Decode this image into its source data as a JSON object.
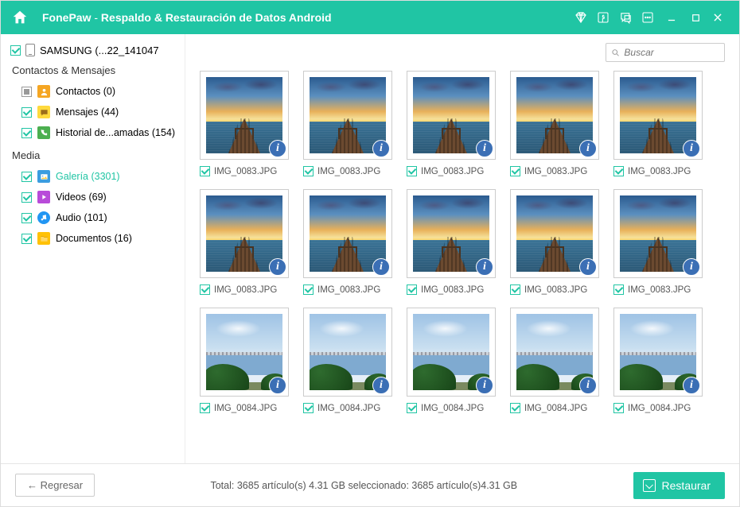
{
  "titlebar": {
    "brand": "FonePaw",
    "separator": " -  ",
    "product": "Respaldo & Restauración de Datos Android"
  },
  "sidebar": {
    "device_name": "SAMSUNG (...22_141047",
    "groups": [
      {
        "title": "Contactos & Mensajes",
        "items": [
          {
            "icon": "contacts",
            "label": "Contactos (0)",
            "check": "partial"
          },
          {
            "icon": "messages",
            "label": "Mensajes (44)",
            "check": "checked"
          },
          {
            "icon": "calllog",
            "label": "Historial de...amadas (154)",
            "check": "checked"
          }
        ]
      },
      {
        "title": "Media",
        "items": [
          {
            "icon": "gallery",
            "label": "Galería (3301)",
            "check": "checked",
            "active": true
          },
          {
            "icon": "videos",
            "label": "Videos (69)",
            "check": "checked"
          },
          {
            "icon": "audio",
            "label": "Audio (101)",
            "check": "checked"
          },
          {
            "icon": "docs",
            "label": "Documentos (16)",
            "check": "checked"
          }
        ]
      }
    ]
  },
  "search": {
    "placeholder": "Buscar"
  },
  "grid": {
    "items": [
      {
        "name": "IMG_0083.JPG",
        "variant": "sunset"
      },
      {
        "name": "IMG_0083.JPG",
        "variant": "sunset"
      },
      {
        "name": "IMG_0083.JPG",
        "variant": "sunset"
      },
      {
        "name": "IMG_0083.JPG",
        "variant": "sunset"
      },
      {
        "name": "IMG_0083.JPG",
        "variant": "sunset"
      },
      {
        "name": "IMG_0083.JPG",
        "variant": "sunset"
      },
      {
        "name": "IMG_0083.JPG",
        "variant": "sunset"
      },
      {
        "name": "IMG_0083.JPG",
        "variant": "sunset"
      },
      {
        "name": "IMG_0083.JPG",
        "variant": "sunset"
      },
      {
        "name": "IMG_0083.JPG",
        "variant": "sunset"
      },
      {
        "name": "IMG_0084.JPG",
        "variant": "coast"
      },
      {
        "name": "IMG_0084.JPG",
        "variant": "coast"
      },
      {
        "name": "IMG_0084.JPG",
        "variant": "coast"
      },
      {
        "name": "IMG_0084.JPG",
        "variant": "coast"
      },
      {
        "name": "IMG_0084.JPG",
        "variant": "coast"
      }
    ]
  },
  "footer": {
    "back": "←  Regresar",
    "status": "Total: 3685 artículo(s) 4.31 GB seleccionado: 3685 artículo(s)4.31 GB",
    "restore": "Restaurar"
  },
  "glyphs": {
    "info": "i",
    "search": "🔍"
  }
}
